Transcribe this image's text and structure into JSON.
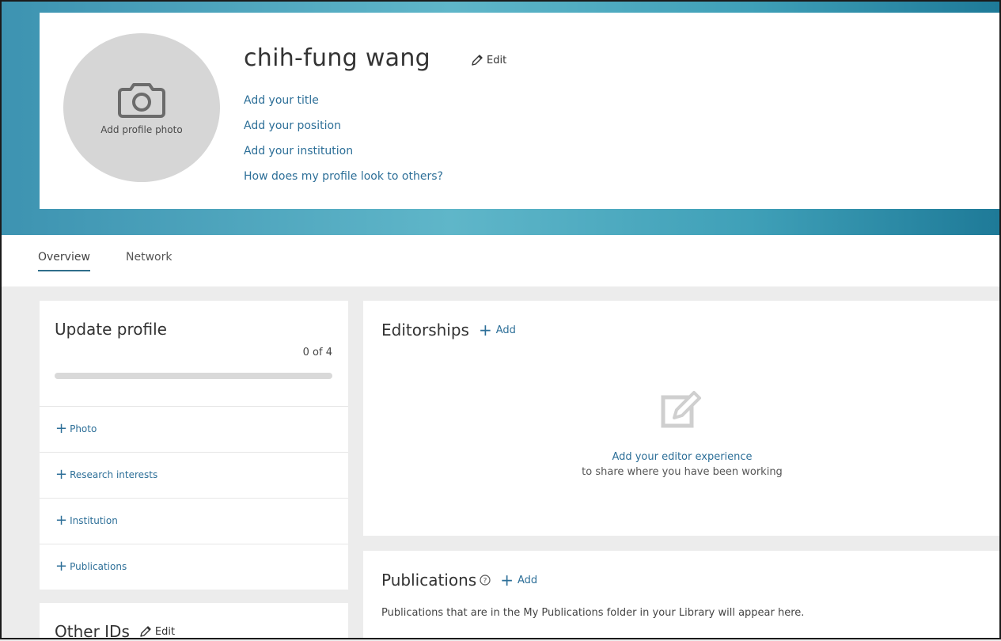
{
  "profile": {
    "name": "chih-fung wang",
    "edit_label": "Edit",
    "add_photo_label": "Add profile photo",
    "links": [
      "Add your title",
      "Add your position",
      "Add your institution",
      "How does my profile look to others?"
    ]
  },
  "tabs": [
    {
      "label": "Overview",
      "active": true
    },
    {
      "label": "Network",
      "active": false
    }
  ],
  "update_profile": {
    "title": "Update profile",
    "progress_text": "0 of 4",
    "progress_completed": 0,
    "progress_total": 4,
    "items": [
      "Photo",
      "Research interests",
      "Institution",
      "Publications"
    ]
  },
  "editorships": {
    "title": "Editorships",
    "add_label": "Add",
    "empty_link": "Add your editor experience",
    "empty_subtext": "to share where you have been working",
    "empty_icon": "edit-note-icon"
  },
  "publications": {
    "title": "Publications",
    "add_label": "Add",
    "description": "Publications that are in the My Publications folder in your Library will appear here."
  },
  "other_ids": {
    "title": "Other IDs",
    "edit_label": "Edit"
  },
  "colors": {
    "accent": "#2d6f98",
    "hero_gradient_start": "#3d93b1",
    "hero_gradient_end": "#1e7a98",
    "avatar_bg": "#d6d6d6"
  }
}
